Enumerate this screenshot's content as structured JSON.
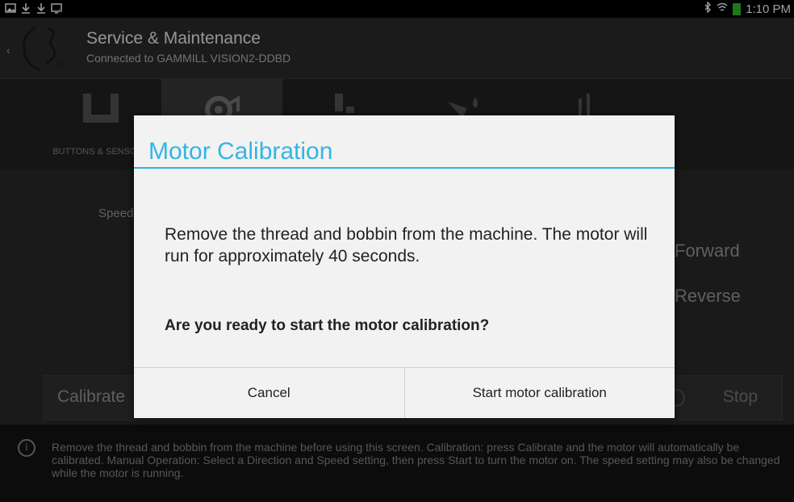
{
  "status_bar": {
    "left_icons": [
      "image-icon",
      "download-icon",
      "download-icon",
      "cast-icon"
    ],
    "right_icons": [
      "bluetooth-icon",
      "wifi-icon",
      "battery-icon"
    ],
    "time": "1:10 PM"
  },
  "header": {
    "title": "Service & Maintenance",
    "subtitle": "Connected to GAMMILL VISION2-DDBD"
  },
  "tabs": [
    {
      "label": "BUTTONS & SENSORS",
      "icon": "button-icon",
      "active": false
    },
    {
      "label": "",
      "icon": "gear-motor-icon",
      "active": true
    },
    {
      "label": "",
      "icon": "device-icon",
      "active": false
    },
    {
      "label": "",
      "icon": "oil-can-icon",
      "active": false
    },
    {
      "label": "",
      "icon": "sliders-icon",
      "active": false
    }
  ],
  "main": {
    "speed_label": "Speed",
    "forward_label": "Forward",
    "reverse_label": "Reverse",
    "calibrate_label": "Calibrate",
    "stop_label": "Stop"
  },
  "help": {
    "text": "Remove the thread and bobbin from the machine before using this screen. Calibration: press Calibrate and the motor will automatically be calibrated. Manual Operation: Select a Direction and Speed setting, then press Start to turn the motor on. The speed setting may also be changed while the motor is running."
  },
  "dialog": {
    "title": "Motor Calibration",
    "message": "Remove the thread and bobbin from the machine. The motor will run for approximately 40 seconds.",
    "question": "Are you ready to start the motor calibration?",
    "cancel_label": "Cancel",
    "confirm_label": "Start motor calibration"
  },
  "colors": {
    "accent": "#33b5e5",
    "dialog_bg": "#f2f2f2"
  }
}
